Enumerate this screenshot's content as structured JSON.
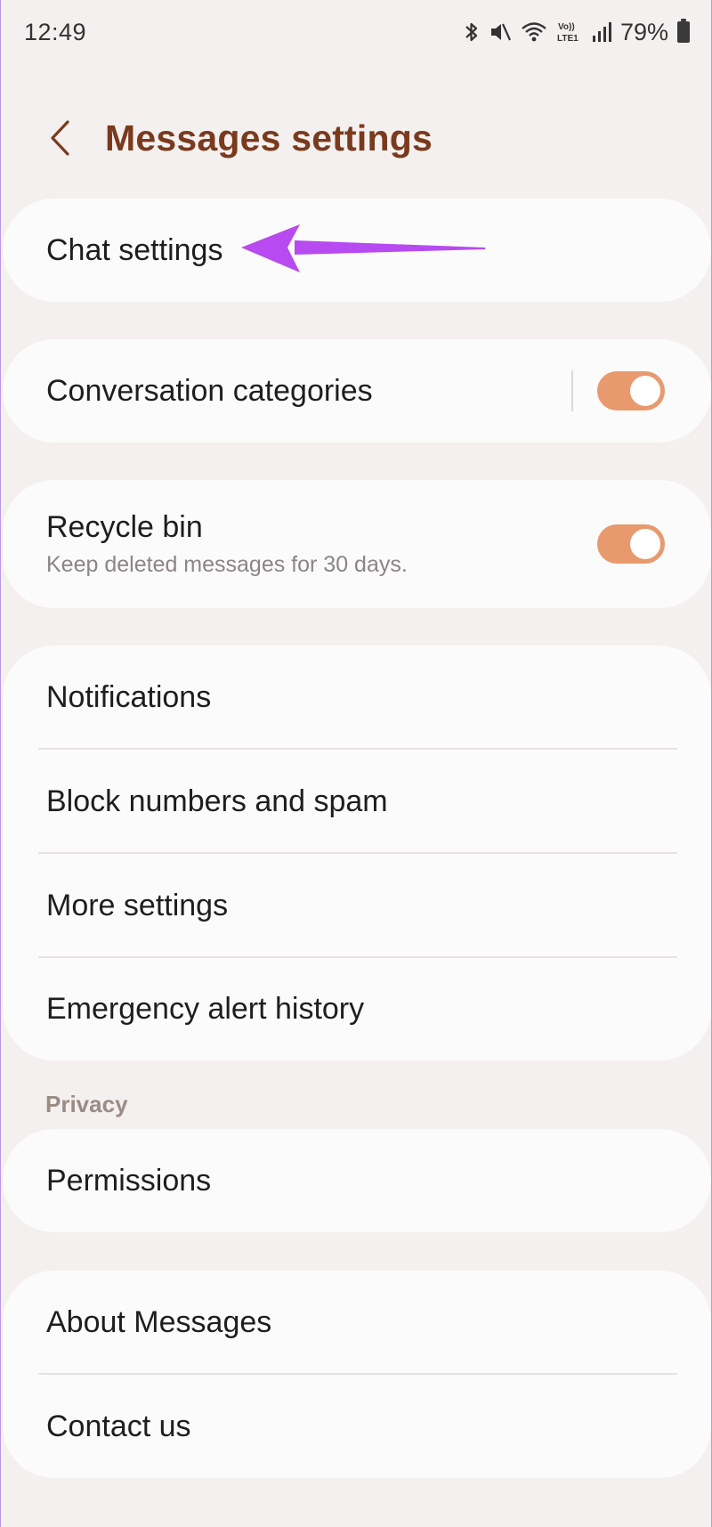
{
  "status_bar": {
    "time": "12:49",
    "battery_percent": "79%",
    "icons": [
      "bluetooth-icon",
      "mute-icon",
      "wifi-icon",
      "volte-lte-icon",
      "signal-icon",
      "battery-icon"
    ],
    "volte_label": "VoLTE1"
  },
  "header": {
    "back_icon": "chevron-left-icon",
    "title": "Messages settings"
  },
  "groups": {
    "chat": {
      "label": "Chat settings"
    },
    "categories": {
      "label": "Conversation categories",
      "toggle_on": true
    },
    "recycle": {
      "label": "Recycle bin",
      "sub": "Keep deleted messages for 30 days.",
      "toggle_on": true
    },
    "main_list": {
      "items": [
        {
          "label": "Notifications"
        },
        {
          "label": "Block numbers and spam"
        },
        {
          "label": "More settings"
        },
        {
          "label": "Emergency alert history"
        }
      ]
    },
    "privacy": {
      "section_label": "Privacy",
      "items": [
        {
          "label": "Permissions"
        }
      ]
    },
    "about": {
      "items": [
        {
          "label": "About Messages"
        },
        {
          "label": "Contact us"
        }
      ]
    }
  },
  "annotation": {
    "arrow_color": "#b74af0"
  },
  "colors": {
    "background": "#f3f0ef",
    "title": "#7a3a1d",
    "toggle_on": "#e89a6e"
  }
}
